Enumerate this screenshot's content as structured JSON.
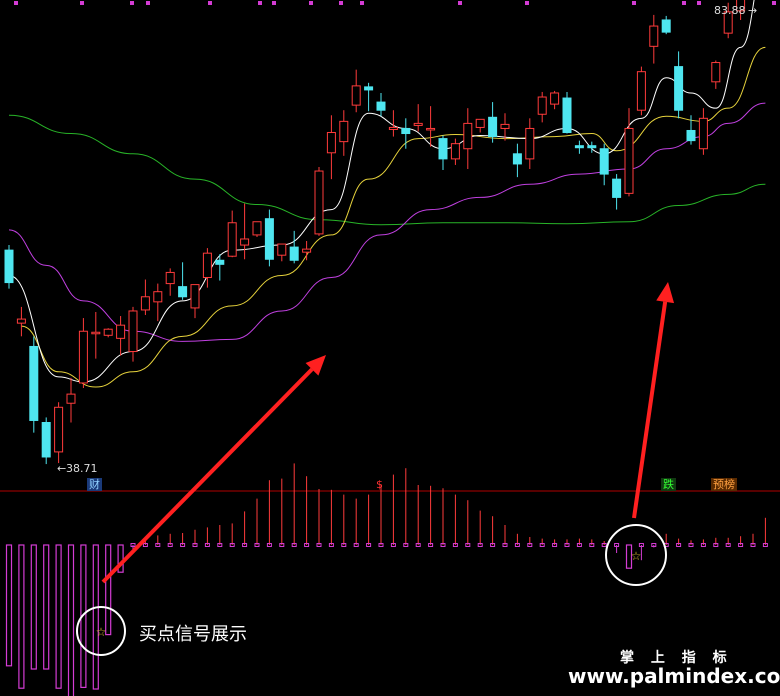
{
  "chart_data": {
    "type": "candlestick",
    "price_high_label": "83.88",
    "price_low_label": "38.71",
    "markers": {
      "cai": "财",
      "dollar": "$",
      "die": "跌",
      "yubang": "预榜"
    },
    "caption": "买点信号展示",
    "watermark_cn": "掌 上 指 标",
    "watermark_url": "www.palmindex.com",
    "colors": {
      "up": "#ff3b3b",
      "down": "#4fe6f0",
      "ma5": "#ffffff",
      "ma10": "#e6d23c",
      "ma20": "#c040e0",
      "ma60": "#28b428",
      "hist": "#d43cd4",
      "arrow": "#ff2020"
    },
    "candles": [
      [
        60.0,
        60.5,
        56.2,
        56.8
      ],
      [
        52.8,
        54.4,
        51.5,
        53.2
      ],
      [
        50.5,
        51.5,
        42.0,
        43.2
      ],
      [
        43.0,
        43.5,
        38.9,
        39.6
      ],
      [
        40.1,
        45.0,
        39.0,
        44.5
      ],
      [
        44.9,
        47.4,
        43.0,
        45.8
      ],
      [
        46.9,
        53.3,
        46.4,
        52.0
      ],
      [
        51.8,
        53.9,
        49.3,
        51.9
      ],
      [
        51.6,
        52.3,
        51.4,
        52.2
      ],
      [
        51.3,
        53.5,
        49.6,
        52.6
      ],
      [
        50.0,
        54.4,
        49.0,
        54.0
      ],
      [
        54.1,
        57.1,
        53.6,
        55.4
      ],
      [
        54.9,
        56.7,
        53.0,
        55.9
      ],
      [
        56.7,
        58.2,
        55.5,
        57.8
      ],
      [
        56.4,
        58.8,
        55.1,
        55.4
      ],
      [
        54.3,
        55.5,
        53.3,
        56.6
      ],
      [
        57.3,
        60.2,
        56.3,
        59.7
      ],
      [
        59.0,
        59.6,
        57.0,
        58.6
      ],
      [
        59.4,
        63.9,
        59.3,
        62.7
      ],
      [
        60.5,
        64.6,
        59.1,
        61.1
      ],
      [
        61.5,
        62.1,
        61.3,
        62.8
      ],
      [
        63.1,
        64.0,
        58.4,
        59.1
      ],
      [
        59.5,
        60.5,
        58.9,
        60.6
      ],
      [
        60.3,
        61.9,
        58.7,
        59.0
      ],
      [
        59.8,
        60.9,
        59.0,
        60.1
      ],
      [
        61.6,
        68.2,
        61.4,
        67.8
      ],
      [
        69.6,
        73.3,
        67.0,
        71.6
      ],
      [
        70.7,
        73.8,
        69.3,
        72.7
      ],
      [
        74.3,
        77.8,
        73.6,
        76.2
      ],
      [
        76.1,
        76.5,
        73.7,
        75.8
      ],
      [
        74.6,
        75.5,
        73.2,
        73.8
      ],
      [
        71.9,
        73.8,
        71.2,
        72.1
      ],
      [
        72.0,
        73.0,
        70.0,
        71.5
      ],
      [
        72.3,
        74.4,
        71.7,
        72.5
      ],
      [
        72.0,
        74.2,
        70.2,
        72.0
      ],
      [
        71.0,
        71.3,
        67.9,
        69.0
      ],
      [
        69.0,
        71.0,
        68.4,
        70.5
      ],
      [
        70.0,
        74.0,
        68.0,
        72.5
      ],
      [
        72.1,
        72.6,
        71.6,
        72.9
      ],
      [
        73.1,
        74.6,
        70.6,
        71.2
      ],
      [
        72.0,
        73.5,
        70.8,
        72.4
      ],
      [
        69.5,
        70.5,
        67.2,
        68.5
      ],
      [
        69.0,
        73.0,
        68.0,
        72.0
      ],
      [
        73.4,
        75.6,
        72.6,
        75.1
      ],
      [
        74.4,
        75.7,
        73.9,
        75.5
      ],
      [
        75.0,
        75.6,
        71.5,
        71.6
      ],
      [
        70.3,
        70.8,
        69.5,
        70.1
      ],
      [
        70.3,
        70.7,
        69.6,
        70.1
      ],
      [
        70.0,
        70.5,
        66.4,
        67.5
      ],
      [
        67.0,
        67.5,
        64.0,
        65.2
      ],
      [
        65.6,
        74.0,
        65.3,
        72.0
      ],
      [
        73.8,
        78.1,
        73.3,
        77.6
      ],
      [
        80.1,
        83.2,
        78.4,
        82.1
      ],
      [
        82.7,
        83.1,
        81.3,
        81.5
      ],
      [
        78.1,
        79.6,
        73.0,
        73.8
      ],
      [
        71.8,
        73.3,
        70.4,
        70.8
      ],
      [
        70.0,
        74.0,
        69.4,
        73.0
      ],
      [
        76.6,
        78.7,
        75.9,
        78.5
      ],
      [
        81.4,
        84.4,
        80.9,
        83.5
      ],
      [
        83.6,
        87.5,
        82.7,
        85.1
      ],
      [
        85.9,
        89.6,
        85.0,
        85.9
      ],
      [
        89.5,
        96.4,
        89.0,
        95.5
      ]
    ],
    "histogram": [
      -15.1,
      -17.9,
      -15.5,
      -15.5,
      -17.9,
      -19.3,
      -17.8,
      -18.0,
      -11.2,
      -3.4,
      -1.0,
      1.0,
      1.2,
      1.4,
      1.5,
      1.9,
      2.2,
      2.5,
      2.7,
      4.2,
      5.8,
      8.1,
      8.3,
      10.2,
      8.6,
      7.0,
      6.9,
      6.3,
      5.8,
      6.3,
      7.6,
      8.8,
      9.6,
      7.5,
      7.4,
      7.1,
      6.3,
      5.6,
      4.3,
      3.6,
      2.5,
      1.4,
      1.0,
      0.8,
      0.7,
      0.7,
      0.8,
      0.7,
      0.5,
      -1.0,
      -2.9,
      -1.9,
      -0.3,
      1.4,
      0.8,
      0.6,
      0.7,
      0.9,
      0.9,
      1.1,
      1.4,
      3.4
    ],
    "ma_lines": {
      "ma5": [
        [
          0,
          57.5
        ],
        [
          4,
          47.5
        ],
        [
          6,
          47.0
        ],
        [
          10,
          50.0
        ],
        [
          14,
          55.0
        ],
        [
          18,
          60.0
        ],
        [
          22,
          60.5
        ],
        [
          26,
          64.0
        ],
        [
          29,
          73.5
        ],
        [
          32,
          72.0
        ],
        [
          35,
          70.0
        ],
        [
          38,
          71.3
        ],
        [
          42,
          71.0
        ],
        [
          45,
          72.0
        ],
        [
          48,
          69.5
        ],
        [
          51,
          73.0
        ],
        [
          53,
          77.0
        ],
        [
          55,
          75.5
        ],
        [
          57,
          74.0
        ],
        [
          59,
          80.0
        ],
        [
          61,
          88.0
        ]
      ],
      "ma10": [
        [
          1,
          52.5
        ],
        [
          4,
          48.0
        ],
        [
          7,
          46.5
        ],
        [
          10,
          48.0
        ],
        [
          14,
          51.5
        ],
        [
          18,
          54.5
        ],
        [
          22,
          57.5
        ],
        [
          26,
          61.5
        ],
        [
          29,
          67.0
        ],
        [
          33,
          71.0
        ],
        [
          36,
          71.4
        ],
        [
          40,
          71.0
        ],
        [
          44,
          71.2
        ],
        [
          47,
          71.5
        ],
        [
          49,
          69.8
        ],
        [
          53,
          73.2
        ],
        [
          56,
          72.7
        ],
        [
          58,
          74.0
        ],
        [
          61,
          80.0
        ]
      ],
      "ma20": [
        [
          0,
          62.0
        ],
        [
          3,
          58.5
        ],
        [
          6,
          55.0
        ],
        [
          10,
          52.0
        ],
        [
          14,
          51.0
        ],
        [
          18,
          51.2
        ],
        [
          22,
          54.0
        ],
        [
          26,
          57.3
        ],
        [
          30,
          61.5
        ],
        [
          34,
          64.0
        ],
        [
          38,
          65.2
        ],
        [
          42,
          66.5
        ],
        [
          46,
          67.5
        ],
        [
          50,
          68.0
        ],
        [
          53,
          70.0
        ],
        [
          56,
          71.2
        ],
        [
          58,
          72.5
        ],
        [
          61,
          74.5
        ]
      ],
      "ma60": [
        [
          0,
          73.3
        ],
        [
          5,
          71.5
        ],
        [
          10,
          69.5
        ],
        [
          15,
          67.0
        ],
        [
          20,
          64.5
        ],
        [
          25,
          63.0
        ],
        [
          30,
          62.5
        ],
        [
          35,
          62.7
        ],
        [
          40,
          62.7
        ],
        [
          45,
          62.6
        ],
        [
          50,
          62.8
        ],
        [
          54,
          64.4
        ],
        [
          58,
          65.5
        ],
        [
          61,
          66.5
        ]
      ]
    }
  }
}
